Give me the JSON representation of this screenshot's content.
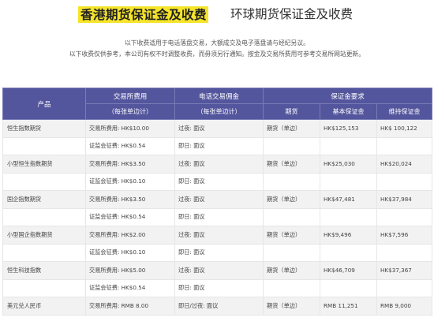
{
  "tabs": {
    "active": "香港期货保证金及收费",
    "inactive": "环球期货保证金及收费"
  },
  "notes": [
    "以下收费适用于电话落盘交易，大额成交及电子落盘请与经纪另议。",
    "以下收费仅供参考，本公司有权不时调整收费，而毋须另行通知。按金及交易所费用可参考交易所网站更新。"
  ],
  "headers": {
    "product": "产品",
    "exchange_fee": "交易所费用",
    "exchange_fee_sub": "（每张单边计）",
    "phone_commission": "电话交易佣金",
    "phone_commission_sub": "（每张单边计）",
    "margin": "保证金要求",
    "futures": "期货",
    "initial_margin": "基本保证金",
    "maintenance_margin": "维持保证金"
  },
  "rows": [
    {
      "product": "恒生指数期货",
      "fee": "交易所费用: HK$10.00",
      "commission": "过夜: 面议",
      "futures": "期货（单边）",
      "initial": "HK$125,153",
      "maintenance": "HK$ 100,122"
    },
    {
      "product": "",
      "fee": "证监会征费: HK$0.54",
      "commission": "即日: 面议",
      "futures": "",
      "initial": "",
      "maintenance": ""
    },
    {
      "product": "小型恒生指数期货",
      "fee": "交易所费用: HK$3.50",
      "commission": "过夜: 面议",
      "futures": "期货（单边）",
      "initial": "HK$25,030",
      "maintenance": "HK$20,024"
    },
    {
      "product": "",
      "fee": "证监会征费: HK$0.10",
      "commission": "即日: 面议",
      "futures": "",
      "initial": "",
      "maintenance": ""
    },
    {
      "product": "国企指数期货",
      "fee": "交易所费用: HK$3.50",
      "commission": "过夜: 面议",
      "futures": "期货（单边）",
      "initial": "HK$47,481",
      "maintenance": "HK$37,984"
    },
    {
      "product": "",
      "fee": "证监会征费: HK$0.54",
      "commission": "即日: 面议",
      "futures": "",
      "initial": "",
      "maintenance": ""
    },
    {
      "product": "小型国企指数期货",
      "fee": "交易所费用: HK$2.00",
      "commission": "过夜: 面议",
      "futures": "期货（单边）",
      "initial": "HK$9,496",
      "maintenance": "HK$7,596"
    },
    {
      "product": "",
      "fee": "证监会征费: HK$0.10",
      "commission": "即日: 面议",
      "futures": "",
      "initial": "",
      "maintenance": ""
    },
    {
      "product": "恒生科技指数",
      "fee": "交易所费用: HK$5.00",
      "commission": "过夜: 面议",
      "futures": "期货（单边）",
      "initial": "HK$46,709",
      "maintenance": "HK$37,367"
    },
    {
      "product": "",
      "fee": "证监会征费: HK$0.54",
      "commission": "即日: 面议",
      "futures": "",
      "initial": "",
      "maintenance": ""
    },
    {
      "product": "美元兑人民币",
      "fee": "交易所费用: RMB 8.00",
      "commission": "即日/过夜: 面议",
      "futures": "期货（单边）",
      "initial": "RMB 11,251",
      "maintenance": "RMB 9,000"
    }
  ]
}
